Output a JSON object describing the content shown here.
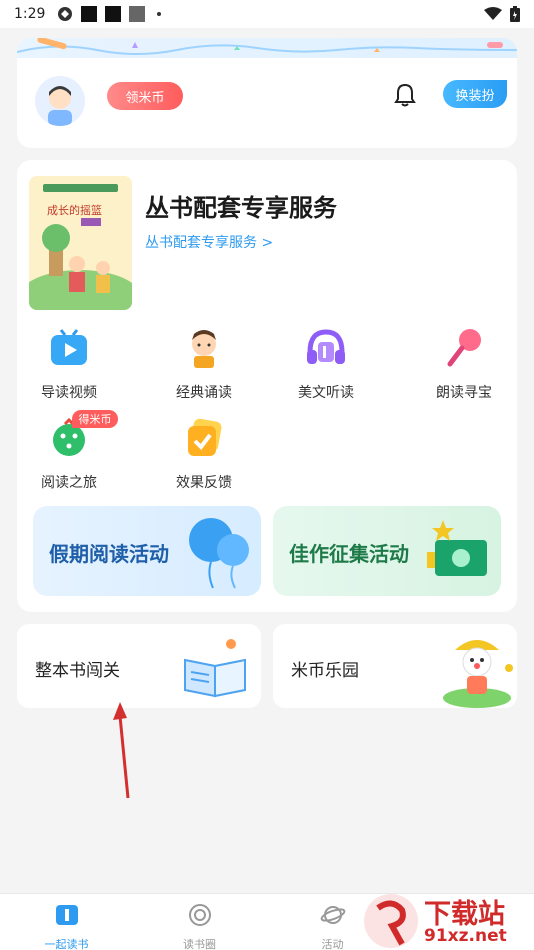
{
  "status_bar": {
    "time": "1:29"
  },
  "profile": {
    "coin_button": "领米币",
    "dress_button": "换装扮"
  },
  "service": {
    "book_cover_title": "成长的摇篮",
    "title": "丛书配套专享服务",
    "link": "丛书配套专享服务 >"
  },
  "features": [
    {
      "label": "导读视频",
      "icon": "tv-icon"
    },
    {
      "label": "经典诵读",
      "icon": "boy-reading-icon"
    },
    {
      "label": "美文听读",
      "icon": "headphones-icon"
    },
    {
      "label": "朗读寻宝",
      "icon": "microphone-icon"
    },
    {
      "label": "阅读之旅",
      "icon": "journey-icon",
      "badge": "得米币"
    },
    {
      "label": "效果反馈",
      "icon": "feedback-check-icon"
    }
  ],
  "promos": {
    "left": "假期阅读活动",
    "right": "佳作征集活动"
  },
  "cards": {
    "left": "整本书闯关",
    "right": "米币乐园"
  },
  "tabs": [
    {
      "label": "一起读书",
      "active": true
    },
    {
      "label": "读书圈",
      "active": false
    },
    {
      "label": "活动",
      "active": false
    }
  ],
  "watermark": {
    "line1": "下载站",
    "line2": "91xz.net"
  },
  "colors": {
    "accent": "#2e9bf0",
    "coin": "#ff5c5c",
    "annotation_arrow": "#d32f2f"
  }
}
